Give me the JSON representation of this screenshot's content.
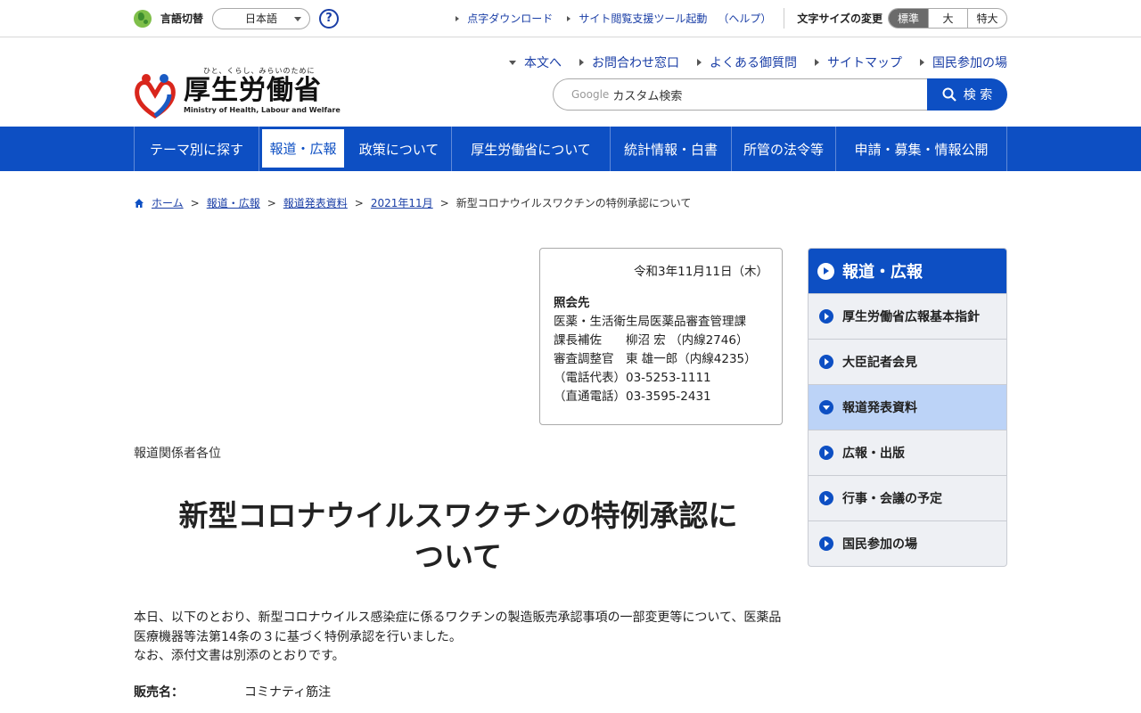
{
  "utility": {
    "lang_label": "言語切替",
    "lang_value": "日本語",
    "help": "?",
    "links": [
      "点字ダウンロード",
      "サイト閲覧支援ツール起動"
    ],
    "help_paren": "（ヘルプ）",
    "fontsize_label": "文字サイズの変更",
    "fontsize_options": [
      "標準",
      "大",
      "特大"
    ]
  },
  "header": {
    "tagline": "ひと、くらし、みらいのために",
    "logo_name": "厚生労働省",
    "logo_en": "Ministry of Health, Labour and Welfare",
    "links": [
      "本文へ",
      "お問合わせ窓口",
      "よくある御質問",
      "サイトマップ",
      "国民参加の場"
    ],
    "search_google": "Google",
    "search_placeholder": "カスタム検索",
    "search_button": "検 索"
  },
  "gnav": [
    "テーマ別に探す",
    "報道・広報",
    "政策について",
    "厚生労働省について",
    "統計情報・白書",
    "所管の法令等",
    "申請・募集・情報公開"
  ],
  "breadcrumb": {
    "items": [
      "ホーム",
      "報道・広報",
      "報道発表資料",
      "2021年11月"
    ],
    "current": "新型コロナウイルスワクチンの特例承認について",
    "sep": ">"
  },
  "contact": {
    "date": "令和3年11月11日（木）",
    "label": "照会先",
    "lines": [
      "医薬・生活衛生局医薬品審査管理課",
      "課長補佐　　柳沼 宏 （内線2746）",
      "審査調整官　東 雄一郎（内線4235）",
      "（電話代表）03-5253-1111",
      "（直通電話）03-3595-2431"
    ]
  },
  "main": {
    "addressee": "報道関係者各位",
    "title_line1": "新型コロナウイルスワクチンの特例承認に",
    "title_line2": "ついて",
    "body_line1": "本日、以下のとおり、新型コロナウイルス感染症に係るワクチンの製造販売承認事項の一部変更等について、医薬品",
    "body_line2": "医療機器等法第14条の３に基づく特例承認を行いました。",
    "body_line3": "なお、添付文書は別添のとおりです。",
    "sales_key": "販売名：",
    "sales_value": "コミナティ筋注"
  },
  "sidebar": {
    "title": "報道・広報",
    "items": [
      "厚生労働省広報基本指針",
      "大臣記者会見",
      "報道発表資料",
      "広報・出版",
      "行事・会議の予定",
      "国民参加の場"
    ],
    "current_index": 2
  },
  "colors": {
    "primary": "#0d4fc3",
    "link": "#1a3ea6",
    "current_bg": "#bcd3f7"
  }
}
